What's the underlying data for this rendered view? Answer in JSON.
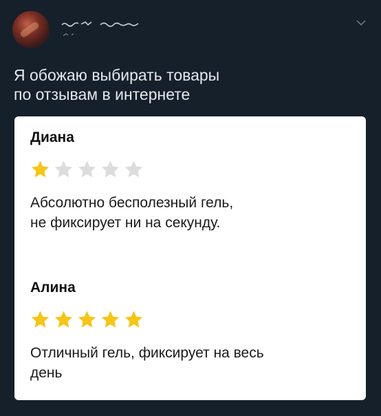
{
  "tweet": {
    "text_line1": "Я обожаю выбирать товары",
    "text_line2": "по отзывам в интернете"
  },
  "header": {
    "avatar_icon": "user-avatar",
    "menu_icon": "chevron-down-icon"
  },
  "reviews": [
    {
      "name": "Диана",
      "rating": 1,
      "max_rating": 5,
      "text_line1": "Абсолютно бесполезный гель,",
      "text_line2": "не фиксирует ни на секунду."
    },
    {
      "name": "Алина",
      "rating": 5,
      "max_rating": 5,
      "text_line1": "Отличный гель, фиксирует на весь",
      "text_line2": "день"
    }
  ],
  "colors": {
    "background": "#15202b",
    "star_filled": "#f5c518",
    "star_empty": "#dcdcdc"
  }
}
